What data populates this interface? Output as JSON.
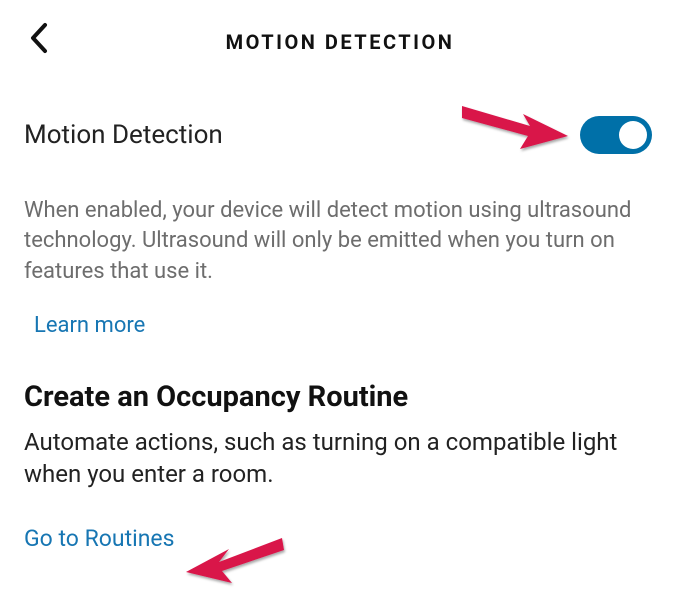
{
  "header": {
    "title": "MOTION DETECTION"
  },
  "motionDetection": {
    "label": "Motion Detection",
    "toggleOn": true,
    "description": "When enabled, your device will detect motion using ultrasound technology. Ultrasound will only be emitted when you turn on features that use it.",
    "learnMoreLabel": "Learn more"
  },
  "occupancy": {
    "title": "Create an Occupancy Routine",
    "description": "Automate actions, such as turning on a compatible light when you enter a room.",
    "linkLabel": "Go to Routines"
  },
  "colors": {
    "link": "#1776b3",
    "toggleActive": "#0070a8",
    "annotationArrow": "#d9134a"
  }
}
